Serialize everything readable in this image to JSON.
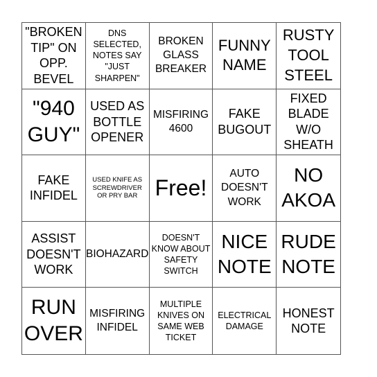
{
  "board": {
    "free_label": "Free!",
    "rows": [
      [
        {
          "text": "\"BROKEN TIP\" ON OPP. BEVEL",
          "size": "lg"
        },
        {
          "text": "DNS SELECTED, NOTES SAY \"JUST SHARPEN\"",
          "size": "sm"
        },
        {
          "text": "BROKEN GLASS BREAKER",
          "size": "md"
        },
        {
          "text": "FUNNY NAME",
          "size": "xl"
        },
        {
          "text": "RUSTY TOOL STEEL",
          "size": "xl"
        }
      ],
      [
        {
          "text": "\"940 GUY\"",
          "size": "xxxl"
        },
        {
          "text": "USED AS BOTTLE OPENER",
          "size": "lg"
        },
        {
          "text": "MISFIRING 4600",
          "size": "md"
        },
        {
          "text": "FAKE BUGOUT",
          "size": "lg"
        },
        {
          "text": "FIXED BLADE W/O SHEATH",
          "size": "lg"
        }
      ],
      [
        {
          "text": "FAKE INFIDEL",
          "size": "lg"
        },
        {
          "text": "USED KNIFE AS SCREWDRIVER OR PRY BAR",
          "size": "xs"
        },
        {
          "text": "Free!",
          "size": "free",
          "free": true
        },
        {
          "text": "AUTO DOESN'T WORK",
          "size": "md"
        },
        {
          "text": "NO AKOA",
          "size": "xxl"
        }
      ],
      [
        {
          "text": "ASSIST DOESN'T WORK",
          "size": "lg"
        },
        {
          "text": "BIOHAZARD",
          "size": "md"
        },
        {
          "text": "DOESN'T KNOW ABOUT SAFETY SWITCH",
          "size": "sm"
        },
        {
          "text": "NICE NOTE",
          "size": "xxl"
        },
        {
          "text": "RUDE NOTE",
          "size": "xxl"
        }
      ],
      [
        {
          "text": "RUN OVER",
          "size": "xxxl"
        },
        {
          "text": "MISFIRING INFIDEL",
          "size": "md"
        },
        {
          "text": "MULTIPLE KNIVES ON SAME WEB TICKET",
          "size": "sm"
        },
        {
          "text": "ELECTRICAL DAMAGE",
          "size": "sm"
        },
        {
          "text": "HONEST NOTE",
          "size": "lg"
        }
      ]
    ],
    "line_color": "#555555",
    "text_color": "#000000",
    "background": "#ffffff"
  }
}
